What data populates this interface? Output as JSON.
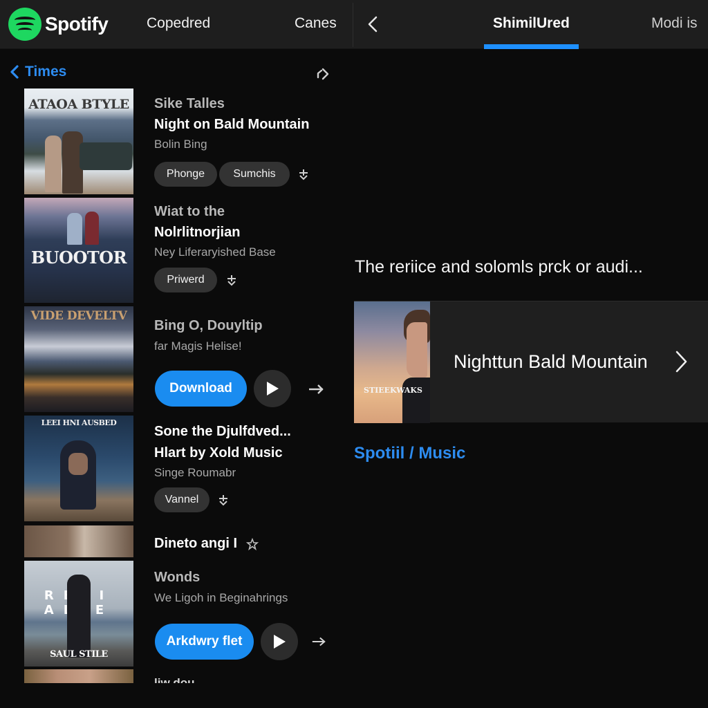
{
  "app": {
    "name": "Spotify",
    "brand_color": "#1ed760",
    "accent_color": "#1a8cf0"
  },
  "topbar": {
    "nav_items": [
      {
        "label": "Copedred"
      },
      {
        "label": "Canes"
      }
    ],
    "back_icon": "chevron-left-icon",
    "tabs": [
      {
        "label": "ShimilUred",
        "active": true
      },
      {
        "label": "Modi is",
        "active": false
      }
    ]
  },
  "list": {
    "header_label": "Times",
    "header_icon": "chevron-left-icon",
    "share_icon": "share-arrow-icon",
    "items": [
      {
        "cover_text": "ATAOA BTYLE",
        "category": "Sike Talles",
        "title": "Night on Bald Mountain",
        "subtitle": "Bolin Bing",
        "pills": [
          "Phonge",
          "Sumchis"
        ],
        "action_icon": "download-icon"
      },
      {
        "cover_text": "BUOOTOR",
        "category": "Wiat to the",
        "title": "Nolrlitnorjian",
        "subtitle": "Ney Liferaryished Base",
        "pills": [
          "Priwerd"
        ],
        "action_icon": "download-icon"
      },
      {
        "cover_text": "VIDE DEVELTV",
        "category": "Bing O, Douyltip",
        "subtitle": "far Magis Helise!",
        "primary_button": "Download",
        "play_icon": "play-icon",
        "action_icon": "arrow-right-icon"
      },
      {
        "cover_text": "LEEI HNI AUSBED",
        "title": "Sone the Djulfdved...",
        "title_line2": "Hlart by Xold Music",
        "subtitle": "Singe Roumabr",
        "pills": [
          "Vannel"
        ],
        "action_icon": "download-icon"
      },
      {
        "title": "Dineto angi I",
        "action_icon": "star-icon"
      },
      {
        "cover_text": "RELI ALIE",
        "cover_subtext": "SAUL STILE",
        "category": "Wonds",
        "subtitle": "We Ligoh in Beginahrings",
        "primary_button": "Arkdwry flet",
        "play_icon": "play-icon",
        "action_icon": "arrow-right-icon"
      },
      {
        "title": "liw dou..."
      }
    ]
  },
  "detail": {
    "description": "The reriice and solomls prck or audi...",
    "feature": {
      "cover_text": "STIEEKWAKS",
      "title": "Nighttun Bald Mountain",
      "chevron_icon": "chevron-right-icon"
    },
    "breadcrumb": "Spotiil / Music"
  }
}
